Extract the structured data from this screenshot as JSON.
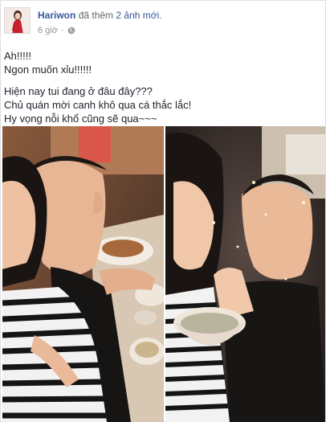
{
  "post": {
    "author": "Hariwon",
    "action": "đã thêm",
    "photos_link": "2 ảnh mới",
    "period": ".",
    "time": "6 giờ",
    "separator": "·",
    "privacy_icon": "globe-icon",
    "text_lines": [
      "Ah!!!!!",
      "Ngon muốn xỉu!!!!!!",
      "Hiện nay tui đang ở đâu đây???",
      "Chủ quán mời canh khô qua cá thắc lắc!",
      "Hy vọng nỗi khổ cũng sẽ qua~~~"
    ]
  },
  "photos": [
    {
      "description_icon": "selfie-photo-left"
    },
    {
      "description_icon": "selfie-photo-right"
    }
  ],
  "colors": {
    "link": "#365899",
    "secondary_text": "#616770",
    "text": "#1d2129"
  }
}
